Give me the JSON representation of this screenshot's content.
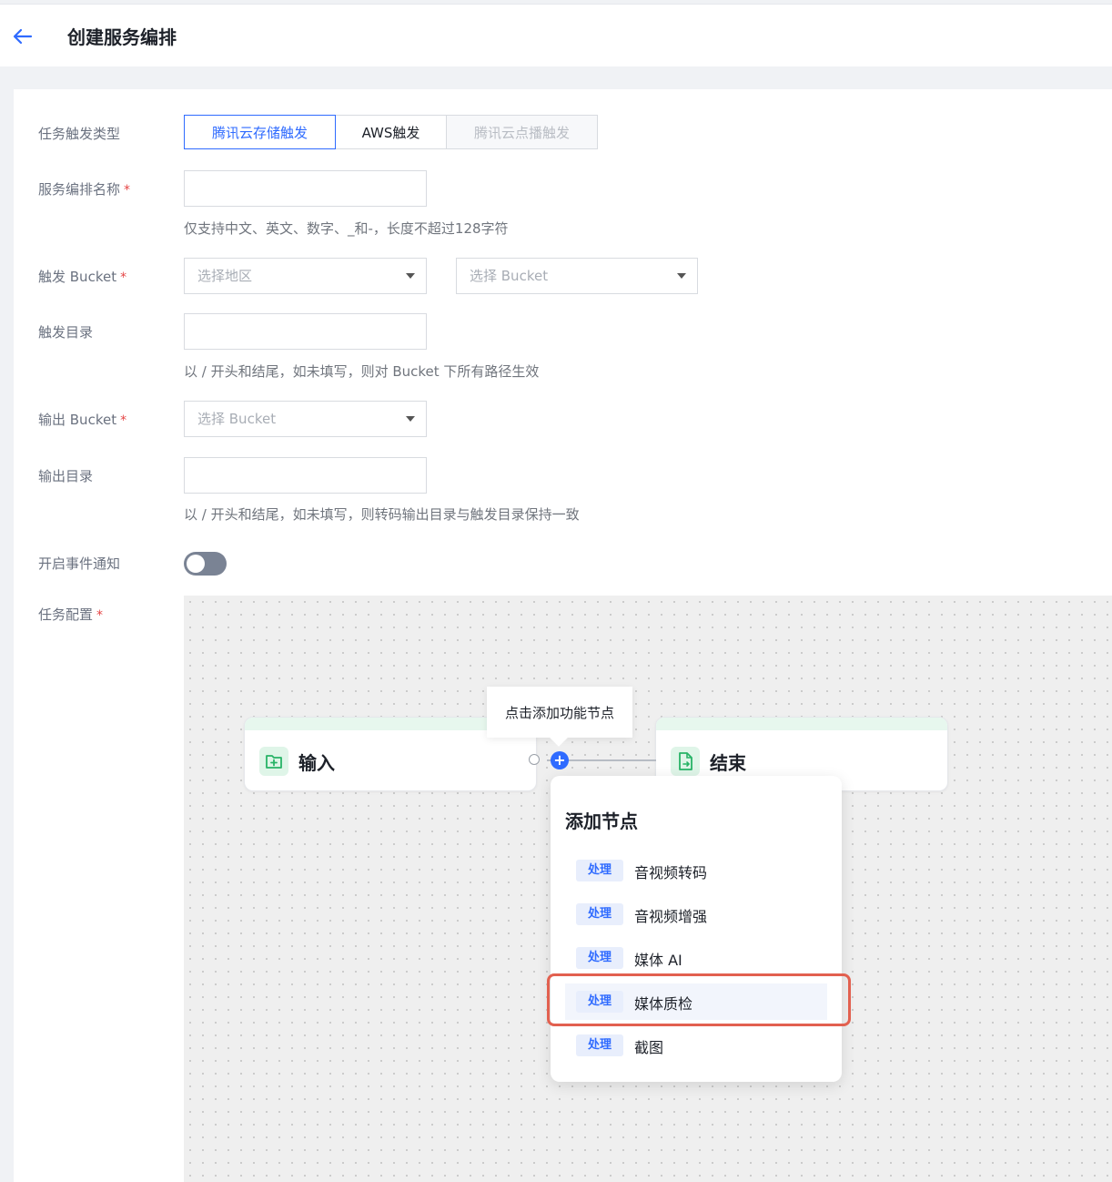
{
  "header": {
    "title": "创建服务编排"
  },
  "form": {
    "trigger_type": {
      "label": "任务触发类型",
      "options": [
        "腾讯云存储触发",
        "AWS触发",
        "腾讯云点播触发"
      ],
      "selected": "腾讯云存储触发"
    },
    "name": {
      "label": "服务编排名称",
      "required": "*",
      "value": "",
      "hint": "仅支持中文、英文、数字、_和-，长度不超过128字符"
    },
    "trigger_bucket": {
      "label": "触发 Bucket",
      "required": "*",
      "region_placeholder": "选择地区",
      "bucket_placeholder": "选择 Bucket"
    },
    "trigger_dir": {
      "label": "触发目录",
      "value": "",
      "hint": "以 / 开头和结尾，如未填写，则对 Bucket 下所有路径生效"
    },
    "output_bucket": {
      "label": "输出 Bucket",
      "required": "*",
      "bucket_placeholder": "选择 Bucket"
    },
    "output_dir": {
      "label": "输出目录",
      "value": "",
      "hint": "以 / 开头和结尾，如未填写，则转码输出目录与触发目录保持一致"
    },
    "event_notify": {
      "label": "开启事件通知",
      "enabled": false
    },
    "task_config": {
      "label": "任务配置",
      "required": "*"
    }
  },
  "canvas": {
    "input_node": {
      "label": "输入",
      "icon": "folder-plus-icon"
    },
    "end_node": {
      "label": "结束",
      "icon": "file-export-icon"
    },
    "tooltip": "点击添加功能节点",
    "add_menu": {
      "title": "添加节点",
      "items": [
        {
          "tag": "处理",
          "label": "音视频转码"
        },
        {
          "tag": "处理",
          "label": "音视频增强"
        },
        {
          "tag": "处理",
          "label": "媒体 AI"
        },
        {
          "tag": "处理",
          "label": "媒体质检",
          "highlighted": true
        },
        {
          "tag": "处理",
          "label": "截图"
        }
      ]
    }
  },
  "colors": {
    "accent": "#2f6bff",
    "highlight_border": "#e2604f",
    "node_band": "#e7f7ee"
  }
}
